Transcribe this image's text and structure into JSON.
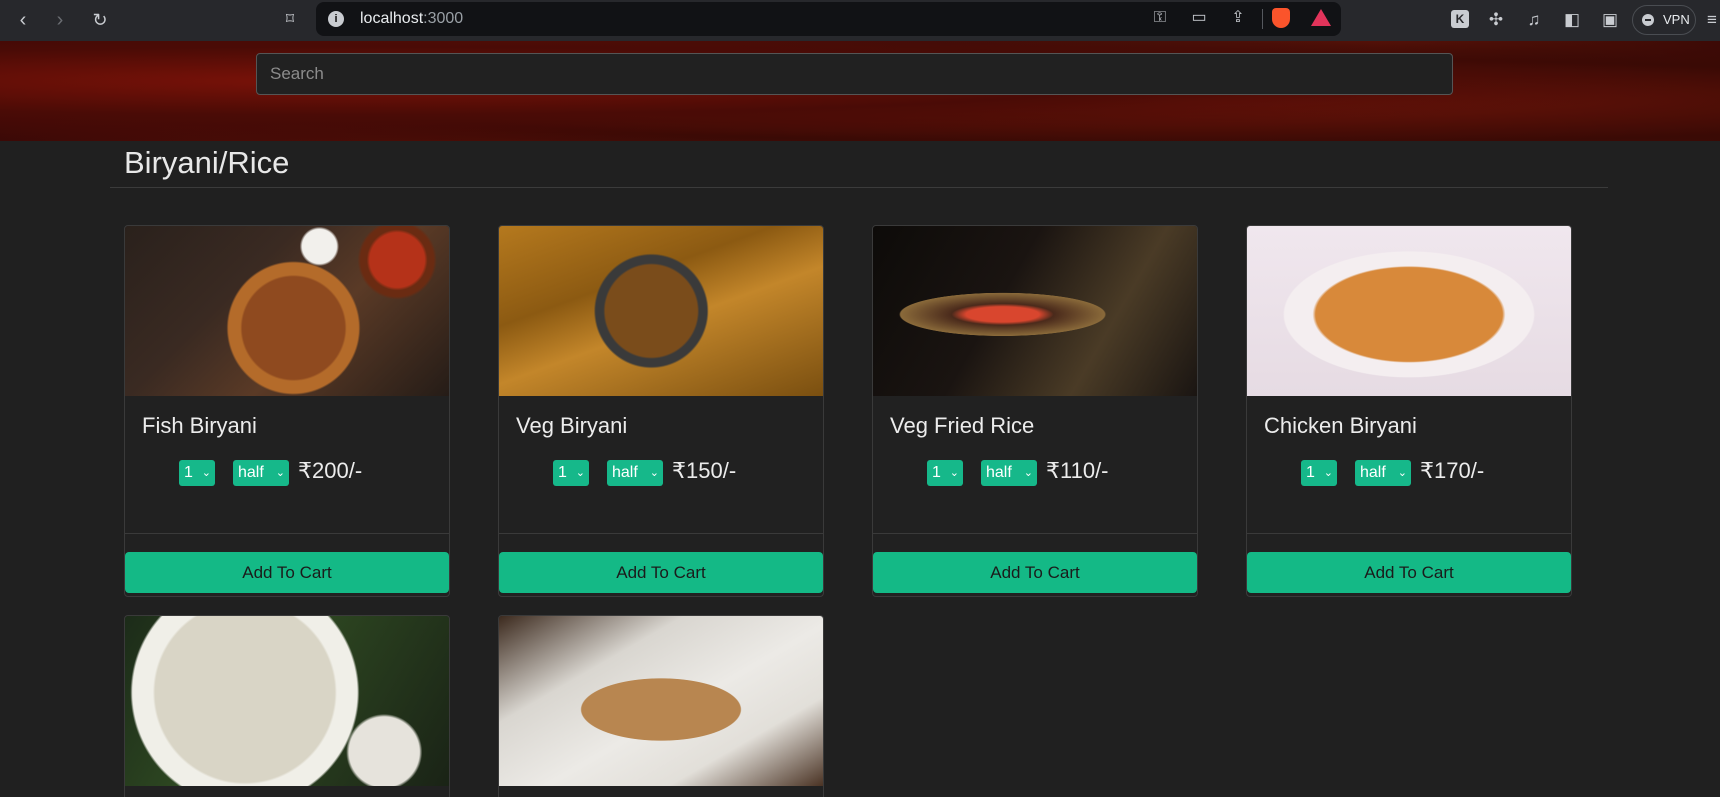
{
  "browser": {
    "url_host": "localhost",
    "url_port": ":3000",
    "vpn_label": "VPN",
    "ext_k_label": "K"
  },
  "search": {
    "placeholder": "Search"
  },
  "section": {
    "title": "Biryani/Rice"
  },
  "cards": [
    {
      "title": "Fish Biryani",
      "qty": "1",
      "size": "half",
      "price": "₹200/-",
      "button": "Add To Cart",
      "image": "fish-biryani-image"
    },
    {
      "title": "Veg Biryani",
      "qty": "1",
      "size": "half",
      "price": "₹150/-",
      "button": "Add To Cart",
      "image": "veg-biryani-image"
    },
    {
      "title": "Veg Fried Rice",
      "qty": "1",
      "size": "half",
      "price": "₹110/-",
      "button": "Add To Cart",
      "image": "veg-fried-rice-image"
    },
    {
      "title": "Chicken Biryani",
      "qty": "1",
      "size": "half",
      "price": "₹170/-",
      "button": "Add To Cart",
      "image": "chicken-biryani-image"
    },
    {
      "image": "shrimp-rice-image"
    },
    {
      "image": "fried-rice-plate-image"
    }
  ],
  "colors": {
    "accent": "#14b986",
    "background": "#202020",
    "banner": "#5a0e07"
  }
}
